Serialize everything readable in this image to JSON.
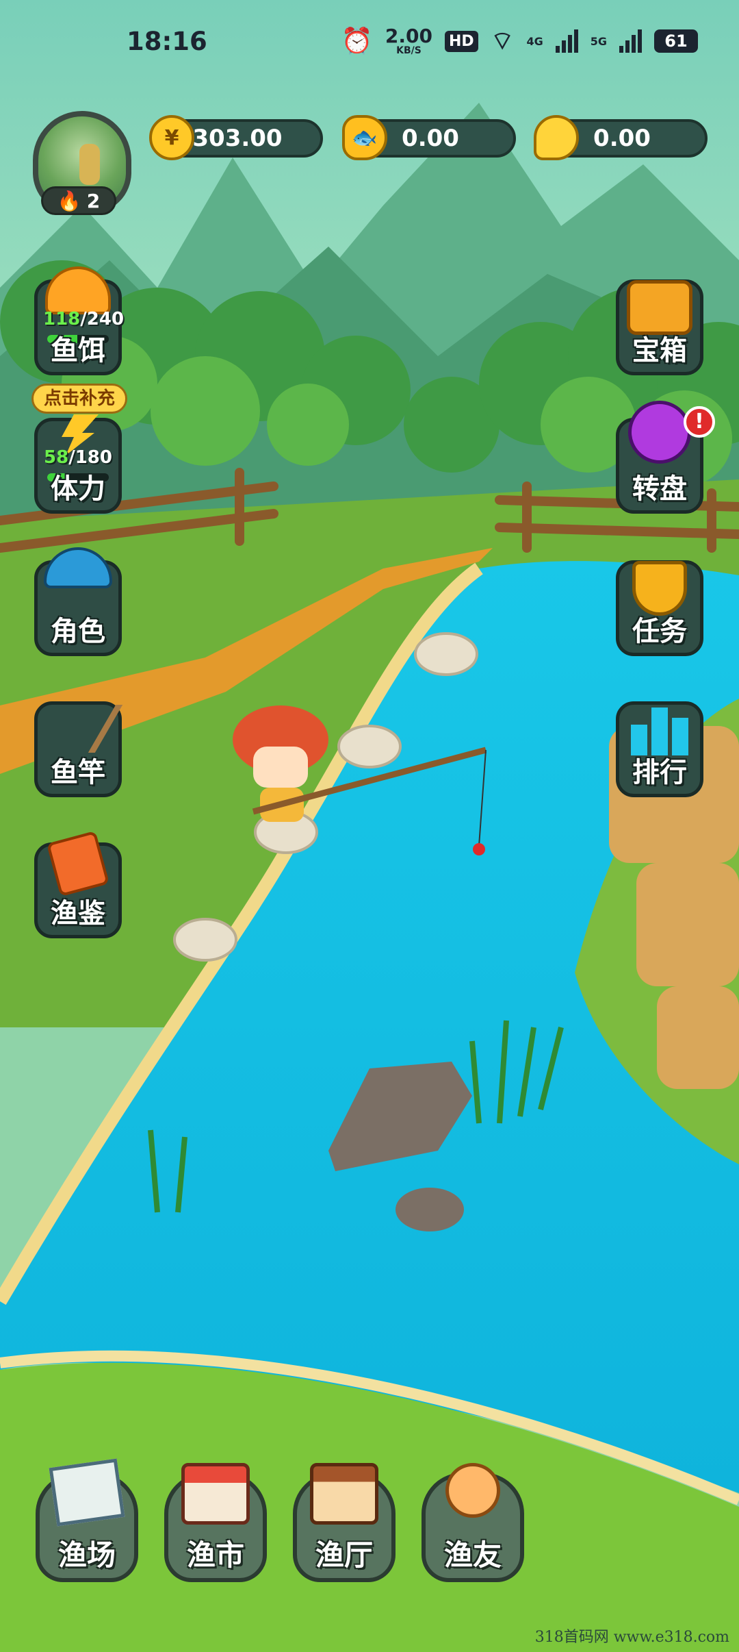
{
  "status_bar": {
    "time": "18:16",
    "net_speed": "2.00",
    "net_unit": "KB/S",
    "hd": "HD",
    "net_4g": "4G",
    "net_5g": "5G",
    "battery": "61"
  },
  "player": {
    "level": "2"
  },
  "currencies": {
    "coins": "303.00",
    "fish": "0.00",
    "gold": "0.00"
  },
  "left_menu": {
    "bait": {
      "label": "鱼饵",
      "current": "118",
      "max": "/240",
      "fill": 0.49
    },
    "refill_tag": "点击补充",
    "stamina": {
      "label": "体力",
      "current": "58",
      "max": "/180",
      "fill": 0.32
    },
    "character": "角色",
    "rod": "鱼竿",
    "handbook": "渔鉴"
  },
  "right_menu": {
    "chest": "宝箱",
    "wheel": "转盘",
    "wheel_alert": "!",
    "tasks": "任务",
    "ranking": "排行"
  },
  "dock": {
    "fishing_ground": "渔场",
    "market": "渔市",
    "hall": "渔厅",
    "friends": "渔友"
  },
  "watermark": "318首码网  www.e318.com",
  "colors": {
    "river": "#14c3e6",
    "grass": "#6fb13a",
    "panel": "#2f4d45"
  }
}
